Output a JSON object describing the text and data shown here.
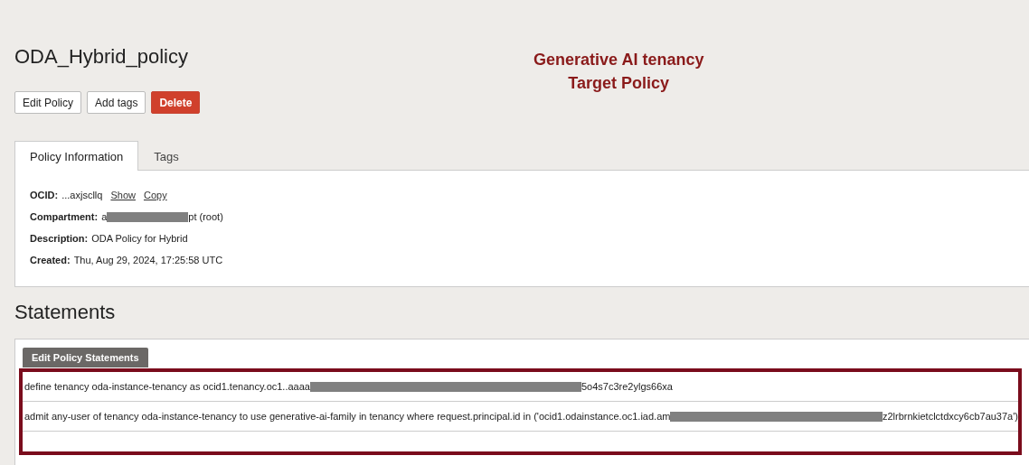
{
  "title": "ODA_Hybrid_policy",
  "annotation": [
    "Generative AI tenancy",
    "Target Policy"
  ],
  "buttons": [
    {
      "label": "Edit Policy",
      "kind": "default"
    },
    {
      "label": "Add tags",
      "kind": "default"
    },
    {
      "label": "Delete",
      "kind": "danger"
    }
  ],
  "tabs": [
    {
      "label": "Policy Information",
      "selected": true
    },
    {
      "label": "Tags",
      "selected": false
    }
  ],
  "info": [
    {
      "label": "OCID:",
      "segments": [
        {
          "kind": "text",
          "text": "...axjscllq"
        }
      ],
      "links": [
        "Show",
        "Copy"
      ]
    },
    {
      "label": "Compartment:",
      "segments": [
        {
          "kind": "text",
          "text": "a"
        },
        {
          "kind": "redacted"
        },
        {
          "kind": "text",
          "text": "pt (root)"
        }
      ]
    },
    {
      "label": "Description:",
      "segments": [
        {
          "kind": "text",
          "text": "ODA Policy for Hybrid"
        }
      ]
    },
    {
      "label": "Created:",
      "segments": [
        {
          "kind": "text",
          "text": "Thu, Aug 29, 2024, 17:25:58 UTC"
        }
      ]
    }
  ],
  "statements_heading": "Statements",
  "edit_statements_button": "Edit Policy Statements",
  "statements": [
    {
      "segments": [
        {
          "kind": "text",
          "text": "define tenancy oda-instance-tenancy as ocid1.tenancy.oc1..aaaa"
        },
        {
          "kind": "redacted"
        },
        {
          "kind": "text",
          "text": "5o4s7c3re2ylgs66xa"
        }
      ]
    },
    {
      "segments": [
        {
          "kind": "text",
          "text": "admit any-user of tenancy oda-instance-tenancy to use generative-ai-family in tenancy where request.principal.id in ('ocid1.odainstance.oc1.iad.am"
        },
        {
          "kind": "redacted"
        },
        {
          "kind": "text",
          "text": "z2lrbrnkietclctdxcy6cb7au37a')"
        }
      ]
    }
  ]
}
